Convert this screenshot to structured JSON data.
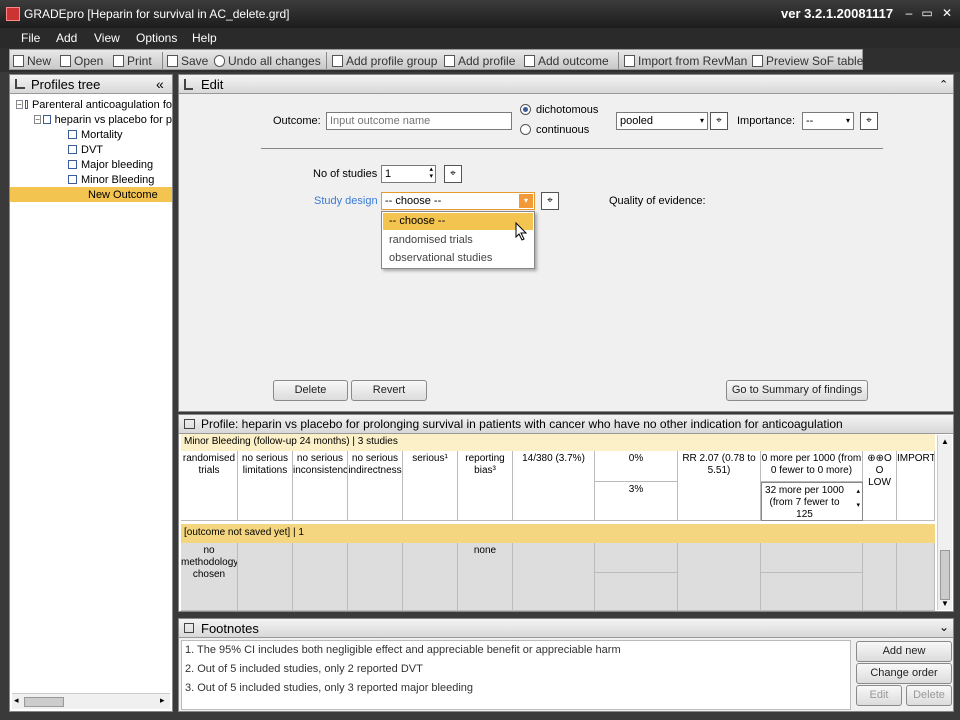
{
  "window": {
    "title": "GRADEpro [Heparin for survival in AC_delete.grd]",
    "version": "ver 3.2.1.20081117",
    "controls": [
      "–",
      "▭",
      "✕"
    ]
  },
  "menu": [
    "File",
    "Add",
    "View",
    "Options",
    "Help"
  ],
  "toolbar": [
    {
      "label": "New",
      "icon": "new-icon"
    },
    {
      "label": "Open",
      "icon": "open-icon"
    },
    {
      "label": "Print",
      "icon": "print-icon"
    },
    {
      "label": "Save",
      "icon": "save-icon"
    },
    {
      "label": "Undo all changes",
      "icon": "undo-icon"
    },
    {
      "label": "Add profile group",
      "icon": "add-profile-group-icon"
    },
    {
      "label": "Add profile",
      "icon": "add-profile-icon"
    },
    {
      "label": "Add outcome",
      "icon": "add-outcome-icon"
    },
    {
      "label": "Import from RevMan",
      "icon": "import-icon"
    },
    {
      "label": "Preview SoF table",
      "icon": "preview-icon"
    }
  ],
  "profiles_tree": {
    "title": "Profiles tree",
    "collapse": "«",
    "items": [
      {
        "label": "Parenteral anticoagulation fo"
      },
      {
        "label": "heparin vs placebo for p"
      },
      {
        "label": "Mortality"
      },
      {
        "label": "DVT"
      },
      {
        "label": "Major bleeding"
      },
      {
        "label": "Minor Bleeding"
      },
      {
        "label": "New Outcome"
      }
    ]
  },
  "edit": {
    "title": "Edit",
    "collapse": "⌃",
    "outcome_label": "Outcome:",
    "outcome_placeholder": "Input outcome name",
    "dichotomous": "dichotomous",
    "continuous": "continuous",
    "pooled": "pooled",
    "importance_label": "Importance:",
    "importance_value": "--",
    "no_studies_label": "No of studies",
    "no_studies_value": "1",
    "study_design_label": "Study design",
    "study_design_value": "-- choose --",
    "quality_label": "Quality of evidence:",
    "dropdown_options": [
      "-- choose --",
      "randomised trials",
      "observational studies"
    ],
    "delete": "Delete",
    "revert": "Revert",
    "go_summary": "Go to Summary of findings"
  },
  "profile": {
    "title": "Profile: heparin vs placebo for prolonging survival in patients with cancer who have no other indication for anticoagulation",
    "group1_header": "Minor Bleeding (follow-up 24 months) | 3 studies",
    "row1": [
      "randomised trials",
      "no serious limitations",
      "no serious inconsistency",
      "no serious indirectness",
      "serious¹",
      "reporting bias³",
      "14/380  (3.7%)",
      "0%",
      "RR 2.07 (0.78 to 5.51)",
      "0 more per 1000 (from 0 fewer to 0 more)",
      "⊕⊕O O LOW",
      "IMPORTANT"
    ],
    "row1_sub": [
      "3%",
      "32 more per 1000 (from 7 fewer to 125"
    ],
    "group2_header": "[outcome not saved yet] | 1",
    "row2": [
      "no methodology chosen",
      "none"
    ]
  },
  "footnotes": {
    "title": "Footnotes",
    "collapse": "⌄",
    "items": [
      "1. The 95% CI includes both negligible effect and appreciable benefit or appreciable harm",
      "2. Out of 5 included studies, only 2 reported DVT",
      "3. Out of 5 included studies, only 3 reported major bleeding"
    ],
    "add_new": "Add new",
    "change_order": "Change order",
    "edit": "Edit",
    "delete": "Delete"
  },
  "colors": {
    "selected": "#f4c451",
    "link": "#3a7bd5",
    "group_header": "#f4d680"
  }
}
